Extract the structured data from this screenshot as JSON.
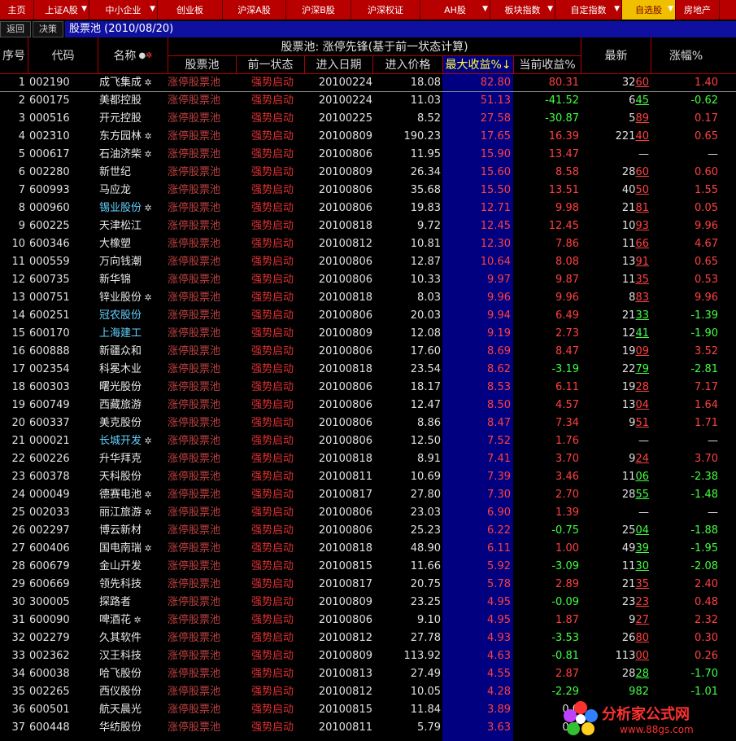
{
  "menu": [
    {
      "label": "主页",
      "w": 42,
      "arrow": false
    },
    {
      "label": "上证A股",
      "w": 68,
      "arrow": true
    },
    {
      "label": "中小企业",
      "w": 84,
      "arrow": true
    },
    {
      "label": "创业板",
      "w": 80,
      "arrow": false
    },
    {
      "label": "沪深A股",
      "w": 78,
      "arrow": false
    },
    {
      "label": "沪深B股",
      "w": 80,
      "arrow": false
    },
    {
      "label": "沪深权证",
      "w": 85,
      "arrow": false
    },
    {
      "label": "AH股",
      "w": 86,
      "arrow": true
    },
    {
      "label": "板块指数",
      "w": 80,
      "arrow": true
    },
    {
      "label": "自定指数",
      "w": 82,
      "arrow": true
    },
    {
      "label": "自选股",
      "w": 66,
      "arrow": true,
      "active": true
    },
    {
      "label": "房地产",
      "w": 54,
      "arrow": false
    }
  ],
  "subbar": {
    "back": "返回",
    "decide": "决策",
    "pool_title": "股票池 (2010/08/20)"
  },
  "header": {
    "idx": "序号",
    "code": "代码",
    "name": "名称",
    "group": "股票池: 涨停先锋(基于前一状态计算)",
    "pool": "股票池",
    "state": "前一状态",
    "date": "进入日期",
    "price": "进入价格",
    "max": "最大收益%↓",
    "cur": "当前收益%",
    "latest": "最新",
    "chg": "涨幅%"
  },
  "colors": {
    "up": "#ff4040",
    "down": "#40ff40",
    "neutral": "#e0e0e0",
    "name_default": "#e8e8e8",
    "name_highlight": "#60d0ff"
  },
  "rows": [
    {
      "i": "1",
      "code": "002190",
      "name": "成飞集成",
      "hl": false,
      "flag": true,
      "pool": "涨停股票池",
      "state": "强势启动",
      "date": "20100224",
      "price": "18.08",
      "max": "82.80",
      "cur": "80.31",
      "cd": "up",
      "latest": "3260",
      "lu": "60",
      "ld": "up",
      "chg": "1.40",
      "gd": "up"
    },
    {
      "i": "2",
      "code": "600175",
      "name": "美都控股",
      "hl": false,
      "flag": false,
      "pool": "涨停股票池",
      "state": "强势启动",
      "date": "20100224",
      "price": "11.03",
      "max": "51.13",
      "cur": "-41.52",
      "cd": "down",
      "latest": "645",
      "lu": "45",
      "ld": "down",
      "chg": "-0.62",
      "gd": "down"
    },
    {
      "i": "3",
      "code": "000516",
      "name": "开元控股",
      "hl": false,
      "flag": false,
      "pool": "涨停股票池",
      "state": "强势启动",
      "date": "20100225",
      "price": "8.52",
      "max": "27.58",
      "cur": "-30.87",
      "cd": "down",
      "latest": "589",
      "lu": "89",
      "ld": "up",
      "chg": "0.17",
      "gd": "up"
    },
    {
      "i": "4",
      "code": "002310",
      "name": "东方园林",
      "hl": false,
      "flag": true,
      "pool": "涨停股票池",
      "state": "强势启动",
      "date": "20100809",
      "price": "190.23",
      "max": "17.65",
      "cur": "16.39",
      "cd": "up",
      "latest": "22140",
      "lu": "40",
      "ld": "up",
      "chg": "0.65",
      "gd": "up"
    },
    {
      "i": "5",
      "code": "000617",
      "name": "石油济柴",
      "hl": false,
      "flag": true,
      "pool": "涨停股票池",
      "state": "强势启动",
      "date": "20100806",
      "price": "11.95",
      "max": "15.90",
      "cur": "13.47",
      "cd": "up",
      "latest": "—",
      "lu": "",
      "ld": "neutral",
      "chg": "—",
      "gd": "neutral"
    },
    {
      "i": "6",
      "code": "002280",
      "name": "新世纪",
      "hl": false,
      "flag": false,
      "pool": "涨停股票池",
      "state": "强势启动",
      "date": "20100809",
      "price": "26.34",
      "max": "15.60",
      "cur": "8.58",
      "cd": "up",
      "latest": "2860",
      "lu": "60",
      "ld": "up",
      "chg": "0.60",
      "gd": "up"
    },
    {
      "i": "7",
      "code": "600993",
      "name": "马应龙",
      "hl": false,
      "flag": false,
      "pool": "涨停股票池",
      "state": "强势启动",
      "date": "20100806",
      "price": "35.68",
      "max": "15.50",
      "cur": "13.51",
      "cd": "up",
      "latest": "4050",
      "lu": "50",
      "ld": "up",
      "chg": "1.55",
      "gd": "up"
    },
    {
      "i": "8",
      "code": "000960",
      "name": "锡业股份",
      "hl": true,
      "flag": true,
      "pool": "涨停股票池",
      "state": "强势启动",
      "date": "20100806",
      "price": "19.83",
      "max": "12.71",
      "cur": "9.98",
      "cd": "up",
      "latest": "2181",
      "lu": "81",
      "ld": "up",
      "chg": "0.05",
      "gd": "up"
    },
    {
      "i": "9",
      "code": "600225",
      "name": "天津松江",
      "hl": false,
      "flag": false,
      "pool": "涨停股票池",
      "state": "强势启动",
      "date": "20100818",
      "price": "9.72",
      "max": "12.45",
      "cur": "12.45",
      "cd": "up",
      "latest": "1093",
      "lu": "93",
      "ld": "up",
      "chg": "9.96",
      "gd": "up"
    },
    {
      "i": "10",
      "code": "600346",
      "name": "大橡塑",
      "hl": false,
      "flag": false,
      "pool": "涨停股票池",
      "state": "强势启动",
      "date": "20100812",
      "price": "10.81",
      "max": "12.30",
      "cur": "7.86",
      "cd": "up",
      "latest": "1166",
      "lu": "66",
      "ld": "up",
      "chg": "4.67",
      "gd": "up"
    },
    {
      "i": "11",
      "code": "000559",
      "name": "万向钱潮",
      "hl": false,
      "flag": false,
      "pool": "涨停股票池",
      "state": "强势启动",
      "date": "20100806",
      "price": "12.87",
      "max": "10.64",
      "cur": "8.08",
      "cd": "up",
      "latest": "1391",
      "lu": "91",
      "ld": "up",
      "chg": "0.65",
      "gd": "up"
    },
    {
      "i": "12",
      "code": "600735",
      "name": "新华锦",
      "hl": false,
      "flag": false,
      "pool": "涨停股票池",
      "state": "强势启动",
      "date": "20100806",
      "price": "10.33",
      "max": "9.97",
      "cur": "9.87",
      "cd": "up",
      "latest": "1135",
      "lu": "35",
      "ld": "up",
      "chg": "0.53",
      "gd": "up"
    },
    {
      "i": "13",
      "code": "000751",
      "name": "锌业股份",
      "hl": false,
      "flag": true,
      "pool": "涨停股票池",
      "state": "强势启动",
      "date": "20100818",
      "price": "8.03",
      "max": "9.96",
      "cur": "9.96",
      "cd": "up",
      "latest": "883",
      "lu": "83",
      "ld": "up",
      "chg": "9.96",
      "gd": "up"
    },
    {
      "i": "14",
      "code": "600251",
      "name": "冠农股份",
      "hl": true,
      "flag": false,
      "pool": "涨停股票池",
      "state": "强势启动",
      "date": "20100806",
      "price": "20.03",
      "max": "9.94",
      "cur": "6.49",
      "cd": "up",
      "latest": "2133",
      "lu": "33",
      "ld": "down",
      "chg": "-1.39",
      "gd": "down"
    },
    {
      "i": "15",
      "code": "600170",
      "name": "上海建工",
      "hl": true,
      "flag": false,
      "pool": "涨停股票池",
      "state": "强势启动",
      "date": "20100809",
      "price": "12.08",
      "max": "9.19",
      "cur": "2.73",
      "cd": "up",
      "latest": "1241",
      "lu": "41",
      "ld": "down",
      "chg": "-1.90",
      "gd": "down"
    },
    {
      "i": "16",
      "code": "600888",
      "name": "新疆众和",
      "hl": false,
      "flag": false,
      "pool": "涨停股票池",
      "state": "强势启动",
      "date": "20100806",
      "price": "17.60",
      "max": "8.69",
      "cur": "8.47",
      "cd": "up",
      "latest": "1909",
      "lu": "09",
      "ld": "up",
      "chg": "3.52",
      "gd": "up"
    },
    {
      "i": "17",
      "code": "002354",
      "name": "科冕木业",
      "hl": false,
      "flag": false,
      "pool": "涨停股票池",
      "state": "强势启动",
      "date": "20100818",
      "price": "23.54",
      "max": "8.62",
      "cur": "-3.19",
      "cd": "down",
      "latest": "2279",
      "lu": "79",
      "ld": "down",
      "chg": "-2.81",
      "gd": "down"
    },
    {
      "i": "18",
      "code": "600303",
      "name": "曙光股份",
      "hl": false,
      "flag": false,
      "pool": "涨停股票池",
      "state": "强势启动",
      "date": "20100806",
      "price": "18.17",
      "max": "8.53",
      "cur": "6.11",
      "cd": "up",
      "latest": "1928",
      "lu": "28",
      "ld": "up",
      "chg": "7.17",
      "gd": "up"
    },
    {
      "i": "19",
      "code": "600749",
      "name": "西藏旅游",
      "hl": false,
      "flag": false,
      "pool": "涨停股票池",
      "state": "强势启动",
      "date": "20100806",
      "price": "12.47",
      "max": "8.50",
      "cur": "4.57",
      "cd": "up",
      "latest": "1304",
      "lu": "04",
      "ld": "up",
      "chg": "1.64",
      "gd": "up"
    },
    {
      "i": "20",
      "code": "600337",
      "name": "美克股份",
      "hl": false,
      "flag": false,
      "pool": "涨停股票池",
      "state": "强势启动",
      "date": "20100806",
      "price": "8.86",
      "max": "8.47",
      "cur": "7.34",
      "cd": "up",
      "latest": "951",
      "lu": "51",
      "ld": "up",
      "chg": "1.71",
      "gd": "up"
    },
    {
      "i": "21",
      "code": "000021",
      "name": "长城开发",
      "hl": true,
      "flag": true,
      "pool": "涨停股票池",
      "state": "强势启动",
      "date": "20100806",
      "price": "12.50",
      "max": "7.52",
      "cur": "1.76",
      "cd": "up",
      "latest": "—",
      "lu": "",
      "ld": "neutral",
      "chg": "—",
      "gd": "neutral"
    },
    {
      "i": "22",
      "code": "600226",
      "name": "升华拜克",
      "hl": false,
      "flag": false,
      "pool": "涨停股票池",
      "state": "强势启动",
      "date": "20100818",
      "price": "8.91",
      "max": "7.41",
      "cur": "3.70",
      "cd": "up",
      "latest": "924",
      "lu": "24",
      "ld": "up",
      "chg": "3.70",
      "gd": "up"
    },
    {
      "i": "23",
      "code": "600378",
      "name": "天科股份",
      "hl": false,
      "flag": false,
      "pool": "涨停股票池",
      "state": "强势启动",
      "date": "20100811",
      "price": "10.69",
      "max": "7.39",
      "cur": "3.46",
      "cd": "up",
      "latest": "1106",
      "lu": "06",
      "ld": "down",
      "chg": "-2.38",
      "gd": "down"
    },
    {
      "i": "24",
      "code": "000049",
      "name": "德赛电池",
      "hl": false,
      "flag": true,
      "pool": "涨停股票池",
      "state": "强势启动",
      "date": "20100817",
      "price": "27.80",
      "max": "7.30",
      "cur": "2.70",
      "cd": "up",
      "latest": "2855",
      "lu": "55",
      "ld": "down",
      "chg": "-1.48",
      "gd": "down"
    },
    {
      "i": "25",
      "code": "002033",
      "name": "丽江旅游",
      "hl": false,
      "flag": true,
      "pool": "涨停股票池",
      "state": "强势启动",
      "date": "20100806",
      "price": "23.03",
      "max": "6.90",
      "cur": "1.39",
      "cd": "up",
      "latest": "—",
      "lu": "",
      "ld": "neutral",
      "chg": "—",
      "gd": "neutral"
    },
    {
      "i": "26",
      "code": "002297",
      "name": "博云新材",
      "hl": false,
      "flag": false,
      "pool": "涨停股票池",
      "state": "强势启动",
      "date": "20100806",
      "price": "25.23",
      "max": "6.22",
      "cur": "-0.75",
      "cd": "down",
      "latest": "2504",
      "lu": "04",
      "ld": "down",
      "chg": "-1.88",
      "gd": "down"
    },
    {
      "i": "27",
      "code": "600406",
      "name": "国电南瑞",
      "hl": false,
      "flag": true,
      "pool": "涨停股票池",
      "state": "强势启动",
      "date": "20100818",
      "price": "48.90",
      "max": "6.11",
      "cur": "1.00",
      "cd": "up",
      "latest": "4939",
      "lu": "39",
      "ld": "down",
      "chg": "-1.95",
      "gd": "down"
    },
    {
      "i": "28",
      "code": "600679",
      "name": "金山开发",
      "hl": false,
      "flag": false,
      "pool": "涨停股票池",
      "state": "强势启动",
      "date": "20100815",
      "price": "11.66",
      "max": "5.92",
      "cur": "-3.09",
      "cd": "down",
      "latest": "1130",
      "lu": "30",
      "ld": "down",
      "chg": "-2.08",
      "gd": "down"
    },
    {
      "i": "29",
      "code": "600669",
      "name": "领先科技",
      "hl": false,
      "flag": false,
      "pool": "涨停股票池",
      "state": "强势启动",
      "date": "20100817",
      "price": "20.75",
      "max": "5.78",
      "cur": "2.89",
      "cd": "up",
      "latest": "2135",
      "lu": "35",
      "ld": "up",
      "chg": "2.40",
      "gd": "up"
    },
    {
      "i": "30",
      "code": "300005",
      "name": "探路者",
      "hl": false,
      "flag": false,
      "pool": "涨停股票池",
      "state": "强势启动",
      "date": "20100809",
      "price": "23.25",
      "max": "4.95",
      "cur": "-0.09",
      "cd": "down",
      "latest": "2323",
      "lu": "23",
      "ld": "up",
      "chg": "0.48",
      "gd": "up"
    },
    {
      "i": "31",
      "code": "600090",
      "name": "啤酒花",
      "hl": false,
      "flag": true,
      "pool": "涨停股票池",
      "state": "强势启动",
      "date": "20100806",
      "price": "9.10",
      "max": "4.95",
      "cur": "1.87",
      "cd": "up",
      "latest": "927",
      "lu": "27",
      "ld": "up",
      "chg": "2.32",
      "gd": "up"
    },
    {
      "i": "32",
      "code": "002279",
      "name": "久其软件",
      "hl": false,
      "flag": false,
      "pool": "涨停股票池",
      "state": "强势启动",
      "date": "20100812",
      "price": "27.78",
      "max": "4.93",
      "cur": "-3.53",
      "cd": "down",
      "latest": "2680",
      "lu": "80",
      "ld": "up",
      "chg": "0.30",
      "gd": "up"
    },
    {
      "i": "33",
      "code": "002362",
      "name": "汉王科技",
      "hl": false,
      "flag": false,
      "pool": "涨停股票池",
      "state": "强势启动",
      "date": "20100809",
      "price": "113.92",
      "max": "4.63",
      "cur": "-0.81",
      "cd": "down",
      "latest": "11300",
      "lu": "00",
      "ld": "up",
      "chg": "0.26",
      "gd": "up"
    },
    {
      "i": "34",
      "code": "600038",
      "name": "哈飞股份",
      "hl": false,
      "flag": false,
      "pool": "涨停股票池",
      "state": "强势启动",
      "date": "20100813",
      "price": "27.49",
      "max": "4.55",
      "cur": "2.87",
      "cd": "up",
      "latest": "2828",
      "lu": "28",
      "ld": "down",
      "chg": "-1.70",
      "gd": "down"
    },
    {
      "i": "35",
      "code": "002265",
      "name": "西仪股份",
      "hl": false,
      "flag": false,
      "pool": "涨停股票池",
      "state": "强势启动",
      "date": "20100812",
      "price": "10.05",
      "max": "4.28",
      "cur": "-2.29",
      "cd": "down",
      "latest": "982",
      "lu": "",
      "ld": "down",
      "chg": "-1.01",
      "gd": "down"
    },
    {
      "i": "36",
      "code": "600501",
      "name": "航天晨光",
      "hl": false,
      "flag": false,
      "pool": "涨停股票池",
      "state": "强势启动",
      "date": "20100815",
      "price": "11.84",
      "max": "3.89",
      "cur": "0.0",
      "cd": "neutral",
      "latest": "",
      "lu": "",
      "ld": "neutral",
      "chg": "",
      "gd": "neutral"
    },
    {
      "i": "37",
      "code": "600448",
      "name": "华纺股份",
      "hl": false,
      "flag": false,
      "pool": "涨停股票池",
      "state": "强势启动",
      "date": "20100811",
      "price": "5.79",
      "max": "3.63",
      "cur": "0.0",
      "cd": "neutral",
      "latest": "",
      "lu": "",
      "ld": "neutral",
      "chg": "",
      "gd": "neutral"
    }
  ],
  "watermark": {
    "title": "分析家公式网",
    "url": "www.88gs.com"
  }
}
